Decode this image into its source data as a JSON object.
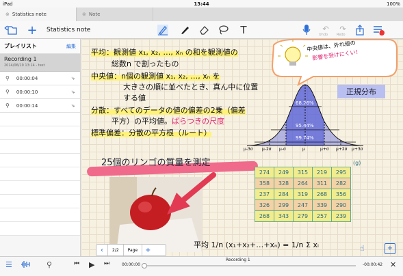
{
  "status": {
    "left": "iPad",
    "time": "13:44",
    "battery": "100%"
  },
  "tabs": [
    {
      "label": "Statistics note",
      "active": true
    },
    {
      "label": "Note",
      "active": false
    }
  ],
  "toolbar": {
    "title": "Statistics note",
    "undo": "Undo",
    "redo": "Redo",
    "badge": "!"
  },
  "sidebar": {
    "title": "プレイリスト",
    "edit": "編集",
    "recording": {
      "name": "Recording 1",
      "date": "2014/06/19 13:14 - test"
    },
    "marks": [
      "00:00:04",
      "00:00:10",
      "00:00:14"
    ]
  },
  "note": {
    "line1": "平均：観測値 x₁, x₂, …, xₙ の和を観測値の",
    "line1b": "総数n で割ったもの",
    "line2": "中央値：n個の観測値 x₁, x₂, …, xₙ を",
    "line2b": "大きさの順に並べたとき、真ん中に位置",
    "line2c": "する値",
    "line3": "分散：すべてのデータの値の偏差の2乗（偏差",
    "line3b": "平方）の平均値。",
    "line3c": "ばらつきの尺度",
    "line4": "標準偏差：分散の平方根（ルート）",
    "bubble1": "中央値は、外れ値の",
    "bubble2": "影響を受けにくい！",
    "nd_label": "正規分布",
    "pct_68": "68.26%",
    "pct_95": "95.44%",
    "pct_99": "99.74%",
    "axis": [
      "μ-3σ",
      "μ-2σ",
      "μ-σ",
      "μ",
      "μ+σ",
      "μ+2σ",
      "μ+3σ"
    ],
    "apple_title": "25個のリンゴの質量を測定",
    "unit": "(g)",
    "avg_formula": "平均 1/n (x₁+x₂+…+xₙ) = 1/n Σ xᵢ"
  },
  "table": [
    [
      "274",
      "249",
      "315",
      "219",
      "295"
    ],
    [
      "358",
      "328",
      "264",
      "311",
      "282"
    ],
    [
      "237",
      "284",
      "319",
      "268",
      "356"
    ],
    [
      "326",
      "299",
      "247",
      "339",
      "290"
    ],
    [
      "268",
      "343",
      "279",
      "257",
      "239"
    ]
  ],
  "pager": {
    "page": "2/2",
    "label": "Page"
  },
  "player": {
    "elapsed": "00:00:00",
    "remaining": "-00:00:42",
    "title": "Recording 1"
  }
}
